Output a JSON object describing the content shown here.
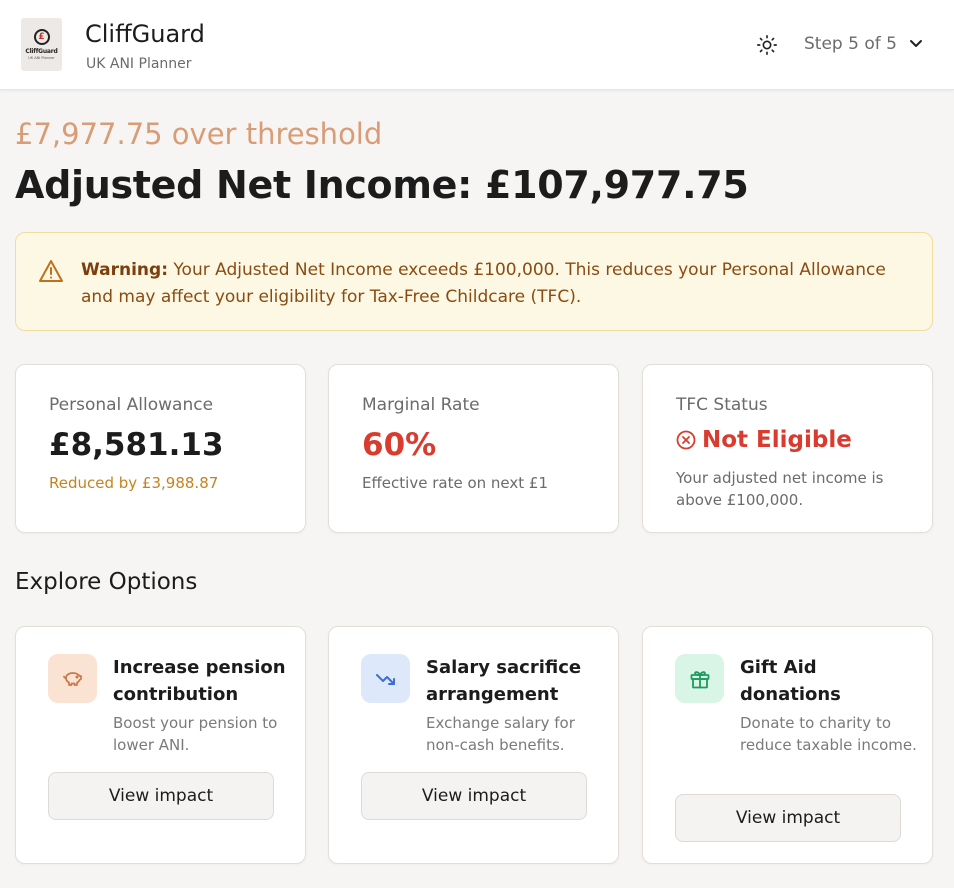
{
  "header": {
    "logo_text": "CliffGuard",
    "logo_sub": "UK ANI Planner",
    "title": "CliffGuard",
    "subtitle": "UK ANI Planner",
    "theme_icon": "sun-icon",
    "step": "Step 5 of 5"
  },
  "summary": {
    "over_threshold": "£7,977.75 over threshold",
    "ani": "Adjusted Net Income: £107,977.75"
  },
  "warning": {
    "label": "Warning:",
    "text": " Your Adjusted Net Income exceeds £100,000. This reduces your Personal Allowance and may affect your eligibility for Tax-Free Childcare (TFC)."
  },
  "stats": [
    {
      "label": "Personal Allowance",
      "value": "£8,581.13",
      "note": "Reduced by £3,988.87"
    },
    {
      "label": "Marginal Rate",
      "value": "60%",
      "note": "Effective rate on next £1"
    },
    {
      "label": "TFC Status",
      "value": "Not Eligible",
      "note": "Your adjusted net income is above £100,000."
    }
  ],
  "explore": {
    "heading": "Explore Options",
    "options": [
      {
        "icon": "piggy-bank-icon",
        "title": "Increase pension contribution",
        "desc": "Boost your pension to lower ANI.",
        "button": "View impact"
      },
      {
        "icon": "trending-down-icon",
        "title": "Salary sacrifice arrangement",
        "desc": "Exchange salary for non-cash benefits.",
        "button": "View impact"
      },
      {
        "icon": "gift-icon",
        "title": "Gift Aid donations",
        "desc": "Donate to charity to reduce taxable income.",
        "button": "View impact"
      }
    ]
  },
  "colors": {
    "accent_over": "#d79d77",
    "danger": "#d93c2e",
    "amber": "#c58220",
    "warning_bg": "#fdf8e3"
  }
}
